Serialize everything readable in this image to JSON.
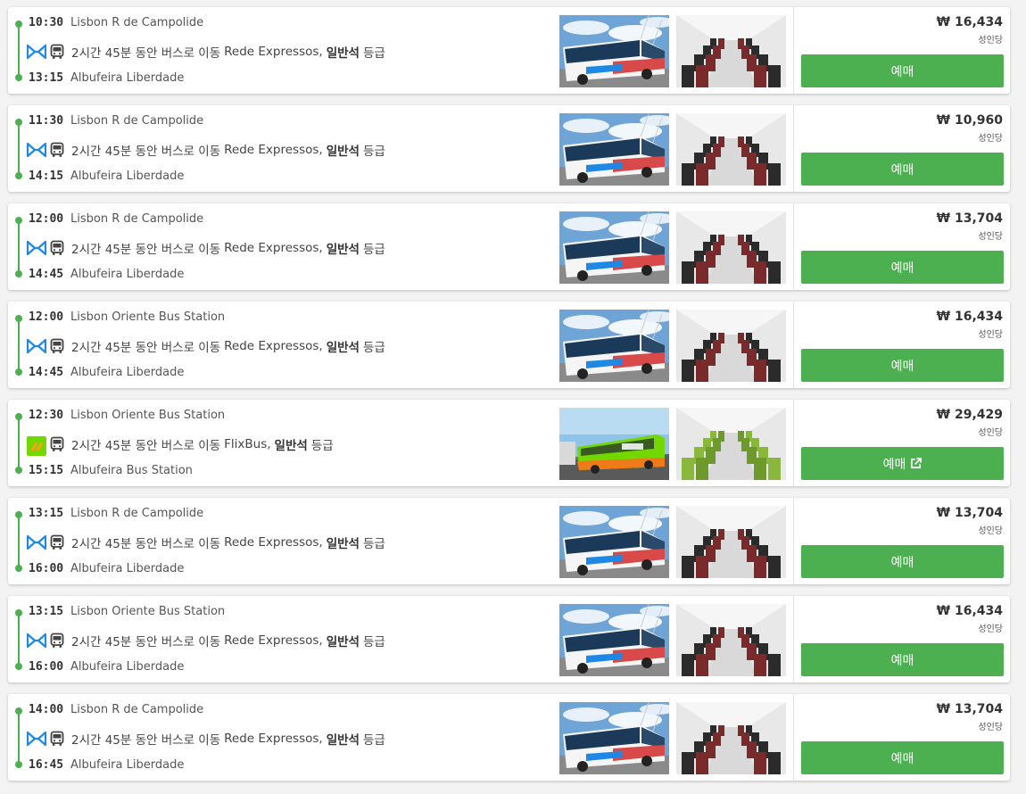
{
  "colors": {
    "accent_green": "#4caf50",
    "rede_expressos_blue": "#1e88e5",
    "flixbus_green": "#73d700"
  },
  "per_person_label": "성인당",
  "book_label": "예매",
  "results": [
    {
      "dep_time": "10:30",
      "dep_station": "Lisbon R de Campolide",
      "arr_time": "13:15",
      "arr_station": "Albufeira Liberdade",
      "duration": "2시간 45분 동안 버스로 이동",
      "operator": "Rede Expressos,",
      "seat_class": "일반석",
      "grade": "등급",
      "price": "₩ 16,434",
      "operator_logo": "rede-expressos-logo",
      "external": false
    },
    {
      "dep_time": "11:30",
      "dep_station": "Lisbon R de Campolide",
      "arr_time": "14:15",
      "arr_station": "Albufeira Liberdade",
      "duration": "2시간 45분 동안 버스로 이동",
      "operator": "Rede Expressos,",
      "seat_class": "일반석",
      "grade": "등급",
      "price": "₩ 10,960",
      "operator_logo": "rede-expressos-logo",
      "external": false
    },
    {
      "dep_time": "12:00",
      "dep_station": "Lisbon R de Campolide",
      "arr_time": "14:45",
      "arr_station": "Albufeira Liberdade",
      "duration": "2시간 45분 동안 버스로 이동",
      "operator": "Rede Expressos,",
      "seat_class": "일반석",
      "grade": "등급",
      "price": "₩ 13,704",
      "operator_logo": "rede-expressos-logo",
      "external": false
    },
    {
      "dep_time": "12:00",
      "dep_station": "Lisbon Oriente Bus Station",
      "arr_time": "14:45",
      "arr_station": "Albufeira Liberdade",
      "duration": "2시간 45분 동안 버스로 이동",
      "operator": "Rede Expressos,",
      "seat_class": "일반석",
      "grade": "등급",
      "price": "₩ 16,434",
      "operator_logo": "rede-expressos-logo",
      "external": false
    },
    {
      "dep_time": "12:30",
      "dep_station": "Lisbon Oriente Bus Station",
      "arr_time": "15:15",
      "arr_station": "Albufeira Bus Station",
      "duration": "2시간 45분 동안 버스로 이동",
      "operator": "FlixBus,",
      "seat_class": "일반석",
      "grade": "등급",
      "price": "₩ 29,429",
      "operator_logo": "flixbus-logo",
      "external": true
    },
    {
      "dep_time": "13:15",
      "dep_station": "Lisbon R de Campolide",
      "arr_time": "16:00",
      "arr_station": "Albufeira Liberdade",
      "duration": "2시간 45분 동안 버스로 이동",
      "operator": "Rede Expressos,",
      "seat_class": "일반석",
      "grade": "등급",
      "price": "₩ 13,704",
      "operator_logo": "rede-expressos-logo",
      "external": false
    },
    {
      "dep_time": "13:15",
      "dep_station": "Lisbon Oriente Bus Station",
      "arr_time": "16:00",
      "arr_station": "Albufeira Liberdade",
      "duration": "2시간 45분 동안 버스로 이동",
      "operator": "Rede Expressos,",
      "seat_class": "일반석",
      "grade": "등급",
      "price": "₩ 16,434",
      "operator_logo": "rede-expressos-logo",
      "external": false
    },
    {
      "dep_time": "14:00",
      "dep_station": "Lisbon R de Campolide",
      "arr_time": "16:45",
      "arr_station": "Albufeira Liberdade",
      "duration": "2시간 45분 동안 버스로 이동",
      "operator": "Rede Expressos,",
      "seat_class": "일반석",
      "grade": "등급",
      "price": "₩ 13,704",
      "operator_logo": "rede-expressos-logo",
      "external": false
    }
  ]
}
